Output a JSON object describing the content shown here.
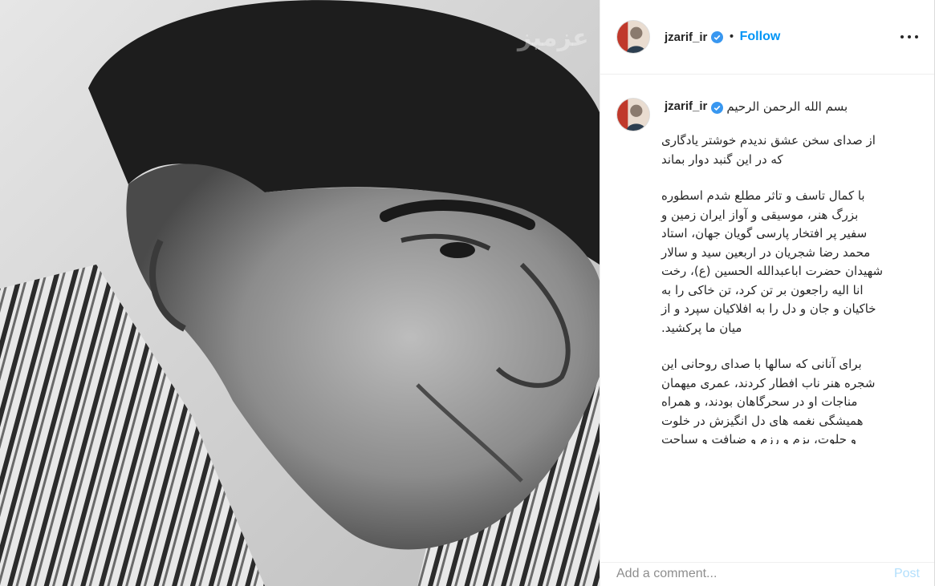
{
  "post": {
    "watermark": "عزمیز",
    "image_alt": "Black and white portrait of Mohammad Reza Shajarian"
  },
  "header": {
    "username": "jzarif_ir",
    "separator": "•",
    "follow_label": "Follow"
  },
  "caption": {
    "username": "jzarif_ir",
    "first_line": "بسم الله الرحمن الرحیم",
    "paragraphs": [
      "از صدای سخن عشق ندیدم خوشتر یادگاری\nکه در این گنبد دوار بماند",
      "با کمال تاسف و تاثر مطلع شدم اسطوره\nبزرگ هنر، موسیقی و آواز ایران زمین و\nسفیر پر افتخار پارسی گویان جهان، استاد\nمحمد رضا شجریان در اربعین سید و سالار\nشهیدان حضرت اباعبدالله الحسین (ع)، رخت\nانا الیه راجعون بر تن کرد، تن خاکی را به\nخاکیان و جان و دل را به افلاکیان سپرد و از\nمیان ما پرکشید.",
      "برای آنانی که سالها با صدای روحانی این\nشجره هنر ناب افطار کردند، عمری میهمان\nمناجات او در سحرگاهان بودند، و همراه\nهمیشگی نغمه های دل انگیزش در خلوت\nو جلوت، بزم و رزم و ضیافت و سیاحت\nبودند این فقدان بس سنگین و تلخ است."
    ]
  },
  "comment_box": {
    "placeholder": "Add a comment...",
    "post_label": "Post"
  },
  "colors": {
    "accent": "#0095f6",
    "post_disabled": "#b2dffc",
    "verified": "#3897f0"
  },
  "icons": {
    "verified": "verified-badge-icon",
    "more": "more-options-icon"
  }
}
